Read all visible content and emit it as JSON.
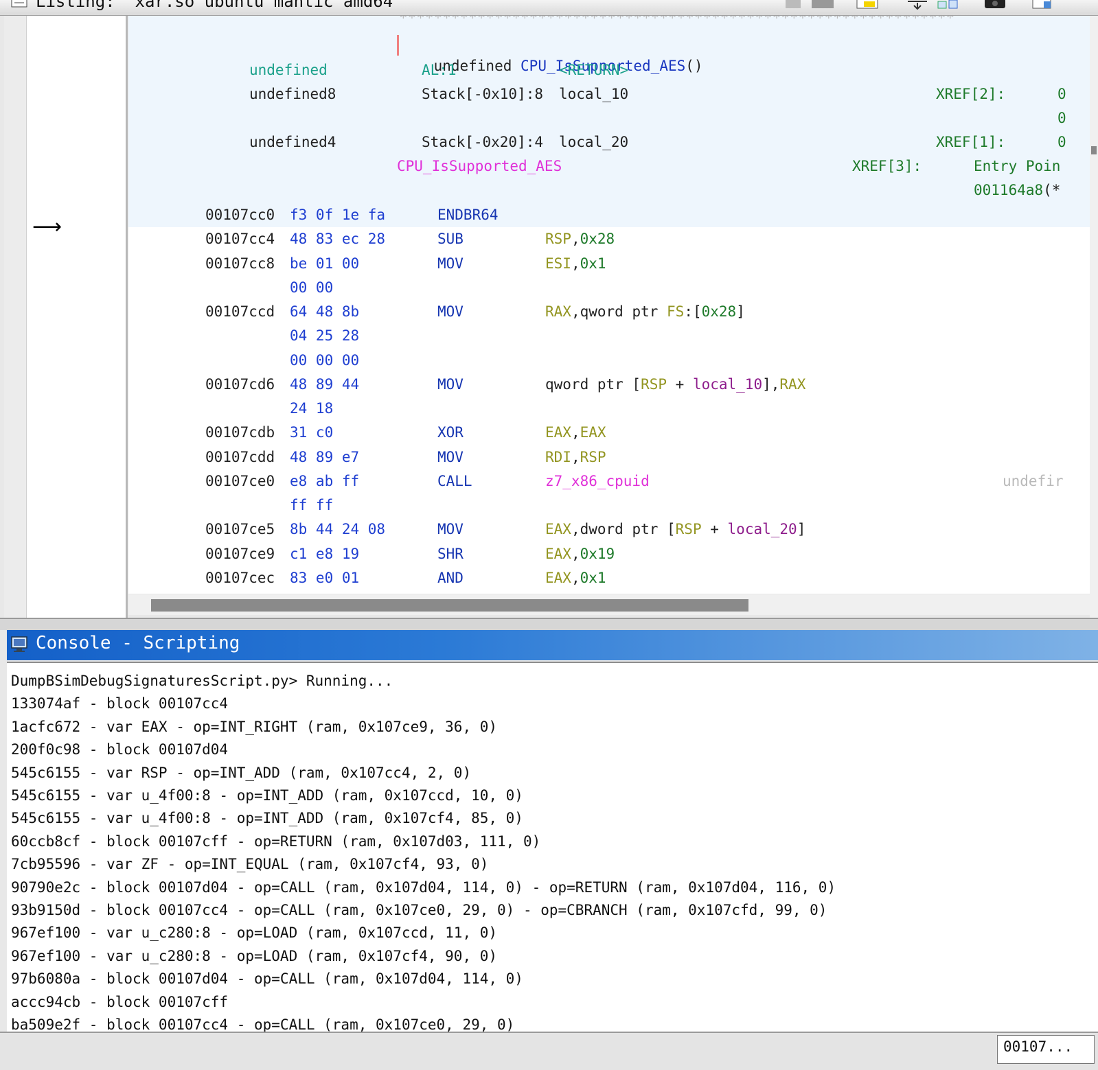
{
  "listing": {
    "title": "Listing:  xar.so ubuntu mantic amd64",
    "separator_stars": "****************************************************************",
    "signature": {
      "ret_type": "undefined",
      "name": "CPU_IsSupported_AES",
      "parens": "()"
    },
    "params": [
      {
        "type": "undefined",
        "storage": "AL:1",
        "name": "<RETURN>",
        "xref": "",
        "xref_val": ""
      },
      {
        "type": "undefined8",
        "storage": "Stack[-0x10]:8",
        "name": "local_10",
        "xref": "XREF[2]:",
        "xref_val": "0"
      },
      {
        "type": "",
        "storage": "",
        "name": "",
        "xref": "",
        "xref_val": "0"
      },
      {
        "type": "undefined4",
        "storage": "Stack[-0x20]:4",
        "name": "local_20",
        "xref": "XREF[1]:",
        "xref_val": "0"
      }
    ],
    "label": {
      "name": "CPU_IsSupported_AES",
      "xref": "XREF[3]:",
      "entry": "Entry Poin",
      "entry2": "001164a8",
      "entry2_suffix": "(*"
    },
    "instructions": [
      {
        "addr": "00107cc0",
        "bytes": "f3 0f 1e fa",
        "mnemonic": "ENDBR64",
        "operands": []
      },
      {
        "addr": "00107cc4",
        "bytes": "48 83 ec 28",
        "mnemonic": "SUB",
        "operands": [
          [
            "RSP",
            "olive"
          ],
          [
            ",",
            "black"
          ],
          [
            "0x28",
            "green"
          ]
        ]
      },
      {
        "addr": "00107cc8",
        "bytes": "be 01 00",
        "mnemonic": "MOV",
        "operands": [
          [
            "ESI",
            "olive"
          ],
          [
            ",",
            "black"
          ],
          [
            "0x1",
            "green"
          ]
        ]
      },
      {
        "addr": "",
        "bytes": "00 00",
        "mnemonic": "",
        "operands": []
      },
      {
        "addr": "00107ccd",
        "bytes": "64 48 8b",
        "mnemonic": "MOV",
        "operands": [
          [
            "RAX",
            "olive"
          ],
          [
            ",qword ptr ",
            "black"
          ],
          [
            "FS",
            "olive"
          ],
          [
            ":[",
            "black"
          ],
          [
            "0x28",
            "green"
          ],
          [
            "]",
            "black"
          ]
        ]
      },
      {
        "addr": "",
        "bytes": "04 25 28",
        "mnemonic": "",
        "operands": []
      },
      {
        "addr": "",
        "bytes": "00 00 00",
        "mnemonic": "",
        "operands": []
      },
      {
        "addr": "00107cd6",
        "bytes": "48 89 44",
        "mnemonic": "MOV",
        "operands": [
          [
            "qword ptr [",
            "black"
          ],
          [
            "RSP",
            "olive"
          ],
          [
            " + ",
            "black"
          ],
          [
            "local_10",
            "purple"
          ],
          [
            "],",
            "black"
          ],
          [
            "RAX",
            "olive"
          ]
        ]
      },
      {
        "addr": "",
        "bytes": "24 18",
        "mnemonic": "",
        "operands": []
      },
      {
        "addr": "00107cdb",
        "bytes": "31 c0",
        "mnemonic": "XOR",
        "operands": [
          [
            "EAX",
            "olive"
          ],
          [
            ",",
            "black"
          ],
          [
            "EAX",
            "olive"
          ]
        ]
      },
      {
        "addr": "00107cdd",
        "bytes": "48 89 e7",
        "mnemonic": "MOV",
        "operands": [
          [
            "RDI",
            "olive"
          ],
          [
            ",",
            "black"
          ],
          [
            "RSP",
            "olive"
          ]
        ]
      },
      {
        "addr": "00107ce0",
        "bytes": "e8 ab ff",
        "mnemonic": "CALL",
        "operands": [
          [
            "z7_x86_cpuid",
            "mag"
          ]
        ],
        "comment": "undefir"
      },
      {
        "addr": "",
        "bytes": "ff ff",
        "mnemonic": "",
        "operands": []
      },
      {
        "addr": "00107ce5",
        "bytes": "8b 44 24 08",
        "mnemonic": "MOV",
        "operands": [
          [
            "EAX",
            "olive"
          ],
          [
            ",dword ptr [",
            "black"
          ],
          [
            "RSP",
            "olive"
          ],
          [
            " + ",
            "black"
          ],
          [
            "local_20",
            "purple"
          ],
          [
            "]",
            "black"
          ]
        ]
      },
      {
        "addr": "00107ce9",
        "bytes": "c1 e8 19",
        "mnemonic": "SHR",
        "operands": [
          [
            "EAX",
            "olive"
          ],
          [
            ",",
            "black"
          ],
          [
            "0x19",
            "green"
          ]
        ]
      },
      {
        "addr": "00107cec",
        "bytes": "83 e0 01",
        "mnemonic": "AND",
        "operands": [
          [
            "EAX",
            "olive"
          ],
          [
            ",",
            "black"
          ],
          [
            "0x1",
            "green"
          ]
        ]
      }
    ]
  },
  "console": {
    "title": "Console - Scripting",
    "lines": [
      "DumpBSimDebugSignaturesScript.py> Running...",
      "133074af - block 00107cc4",
      "1acfc672 - var EAX - op=INT_RIGHT (ram, 0x107ce9, 36, 0)",
      "200f0c98 - block 00107d04",
      "545c6155 - var RSP - op=INT_ADD (ram, 0x107cc4, 2, 0)",
      "545c6155 - var u_4f00:8 - op=INT_ADD (ram, 0x107ccd, 10, 0)",
      "545c6155 - var u_4f00:8 - op=INT_ADD (ram, 0x107cf4, 85, 0)",
      "60ccb8cf - block 00107cff - op=RETURN (ram, 0x107d03, 111, 0)",
      "7cb95596 - var ZF - op=INT_EQUAL (ram, 0x107cf4, 93, 0)",
      "90790e2c - block 00107d04 - op=CALL (ram, 0x107d04, 114, 0) - op=RETURN (ram, 0x107d04, 116, 0)",
      "93b9150d - block 00107cc4 - op=CALL (ram, 0x107ce0, 29, 0) - op=CBRANCH (ram, 0x107cfd, 99, 0)",
      "967ef100 - var u_c280:8 - op=LOAD (ram, 0x107ccd, 11, 0)",
      "967ef100 - var u_c280:8 - op=LOAD (ram, 0x107cf4, 90, 0)",
      "97b6080a - block 00107d04 - op=CALL (ram, 0x107d04, 114, 0)",
      "accc94cb - block 00107cff",
      "ba509e2f - block 00107cc4 - op=CALL (ram, 0x107ce0, 29, 0)"
    ]
  },
  "status": {
    "field": "00107..."
  },
  "colors": {
    "header_bg": "#eef6fd",
    "console_header": "#1460c8",
    "olive": "#939521",
    "green": "#1e7a2a",
    "purple": "#8e1d8c",
    "magenta": "#e030d8"
  }
}
